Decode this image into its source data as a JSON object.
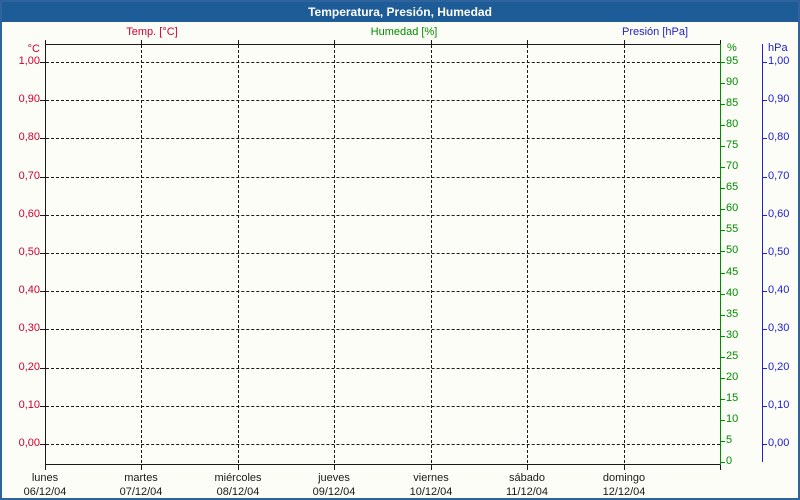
{
  "window": {
    "title": "Temperatura, Presión, Humedad",
    "titlebar_color": "#1d5c96",
    "border_color": "#2f639e",
    "background_color": "#fcfdf6"
  },
  "legend": {
    "items": [
      {
        "label": "Temp. [°C]",
        "color": "#cc0033"
      },
      {
        "label": "Humedad [%]",
        "color": "#008c00"
      },
      {
        "label": "Presión [hPa]",
        "color": "#2020cc"
      }
    ]
  },
  "axes": {
    "left": {
      "unit": "°C",
      "color": "#cc0033",
      "ticks": [
        "1,00",
        "0,90",
        "0,80",
        "0,70",
        "0,60",
        "0,50",
        "0,40",
        "0,30",
        "0,20",
        "0,10",
        "0,00"
      ]
    },
    "right_percent": {
      "unit": "%",
      "color": "#008c00",
      "ticks": [
        "95",
        "90",
        "85",
        "80",
        "75",
        "70",
        "65",
        "60",
        "55",
        "50",
        "45",
        "40",
        "35",
        "30",
        "25",
        "20",
        "15",
        "10",
        "5",
        "0"
      ]
    },
    "right_hpa": {
      "unit": "hPa",
      "color": "#2020cc",
      "ticks": [
        "1,00",
        "0,90",
        "0,80",
        "0,70",
        "0,60",
        "0,50",
        "0,40",
        "0,30",
        "0,20",
        "0,10",
        "0,00"
      ]
    },
    "x": {
      "days": [
        {
          "name": "lunes",
          "date": "06/12/04"
        },
        {
          "name": "martes",
          "date": "07/12/04"
        },
        {
          "name": "miércoles",
          "date": "08/12/04"
        },
        {
          "name": "jueves",
          "date": "09/12/04"
        },
        {
          "name": "viernes",
          "date": "10/12/04"
        },
        {
          "name": "sábado",
          "date": "11/12/04"
        },
        {
          "name": "domingo",
          "date": "12/12/04"
        }
      ]
    }
  },
  "chart_data": {
    "type": "line",
    "title": "Temperatura, Presión, Humedad",
    "x": {
      "label": "",
      "categories": [
        "lunes 06/12/04",
        "martes 07/12/04",
        "miércoles 08/12/04",
        "jueves 09/12/04",
        "viernes 10/12/04",
        "sábado 11/12/04",
        "domingo 12/12/04"
      ]
    },
    "series": [
      {
        "name": "Temp. [°C]",
        "axis": "left",
        "color": "#cc0033",
        "values": []
      },
      {
        "name": "Humedad [%]",
        "axis": "right_percent",
        "color": "#008c00",
        "values": []
      },
      {
        "name": "Presión [hPa]",
        "axis": "right_hpa",
        "color": "#2020cc",
        "values": []
      }
    ],
    "axes": {
      "left": {
        "label": "°C",
        "min": 0.0,
        "max": 1.0,
        "step": 0.1,
        "format": "comma-decimal"
      },
      "right_percent": {
        "label": "%",
        "min": 0,
        "max": 100,
        "step": 5
      },
      "right_hpa": {
        "label": "hPa",
        "min": 0.0,
        "max": 1.0,
        "step": 0.1,
        "format": "comma-decimal"
      }
    },
    "grid": {
      "style": "dashed",
      "horizontal_step_left_axis": 0.1,
      "vertical_step": "1 day"
    },
    "legend_position": "top",
    "note": "empty plot - no data points are drawn"
  }
}
